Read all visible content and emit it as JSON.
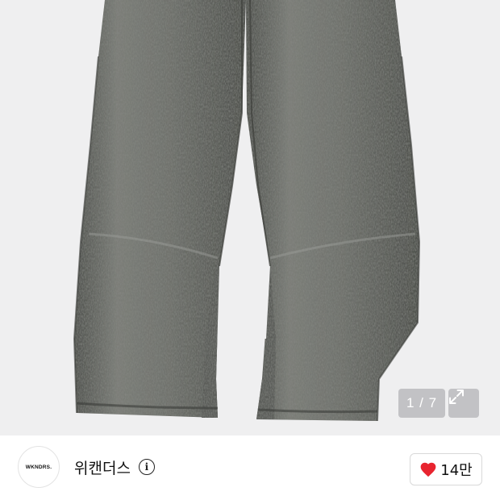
{
  "gallery": {
    "current_page": "1",
    "total_pages": "7",
    "counter_text": "1 / 7",
    "expand_icon": "expand-arrows-icon"
  },
  "brand": {
    "logo_text": "WKNDRS.",
    "name": "위캔더스",
    "info_icon": "info-icon"
  },
  "like": {
    "icon": "heart-icon",
    "count": "14만",
    "heart_color": "#e8242f"
  },
  "colors": {
    "image_background": "#efeff0",
    "denim": "#6b6d68"
  }
}
